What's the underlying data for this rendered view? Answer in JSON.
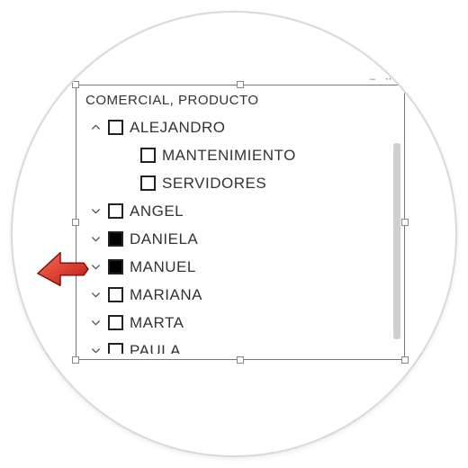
{
  "slicer": {
    "title": "COMERCIAL, PRODUCTO",
    "nodes": [
      {
        "label": "ALEJANDRO",
        "level": 0,
        "expand": "open",
        "checked": false
      },
      {
        "label": "MANTENIMIENTO",
        "level": 1,
        "expand": "none",
        "checked": false
      },
      {
        "label": "SERVIDORES",
        "level": 1,
        "expand": "none",
        "checked": false
      },
      {
        "label": "ANGEL",
        "level": 0,
        "expand": "closed",
        "checked": false
      },
      {
        "label": "DANIELA",
        "level": 0,
        "expand": "closed",
        "checked": true
      },
      {
        "label": "MANUEL",
        "level": 0,
        "expand": "closed",
        "checked": true
      },
      {
        "label": "MARIANA",
        "level": 0,
        "expand": "closed",
        "checked": false
      },
      {
        "label": "MARTA",
        "level": 0,
        "expand": "closed",
        "checked": false
      },
      {
        "label": "PAULA",
        "level": 0,
        "expand": "closed",
        "checked": false
      }
    ]
  },
  "arrow_row_index": 5
}
